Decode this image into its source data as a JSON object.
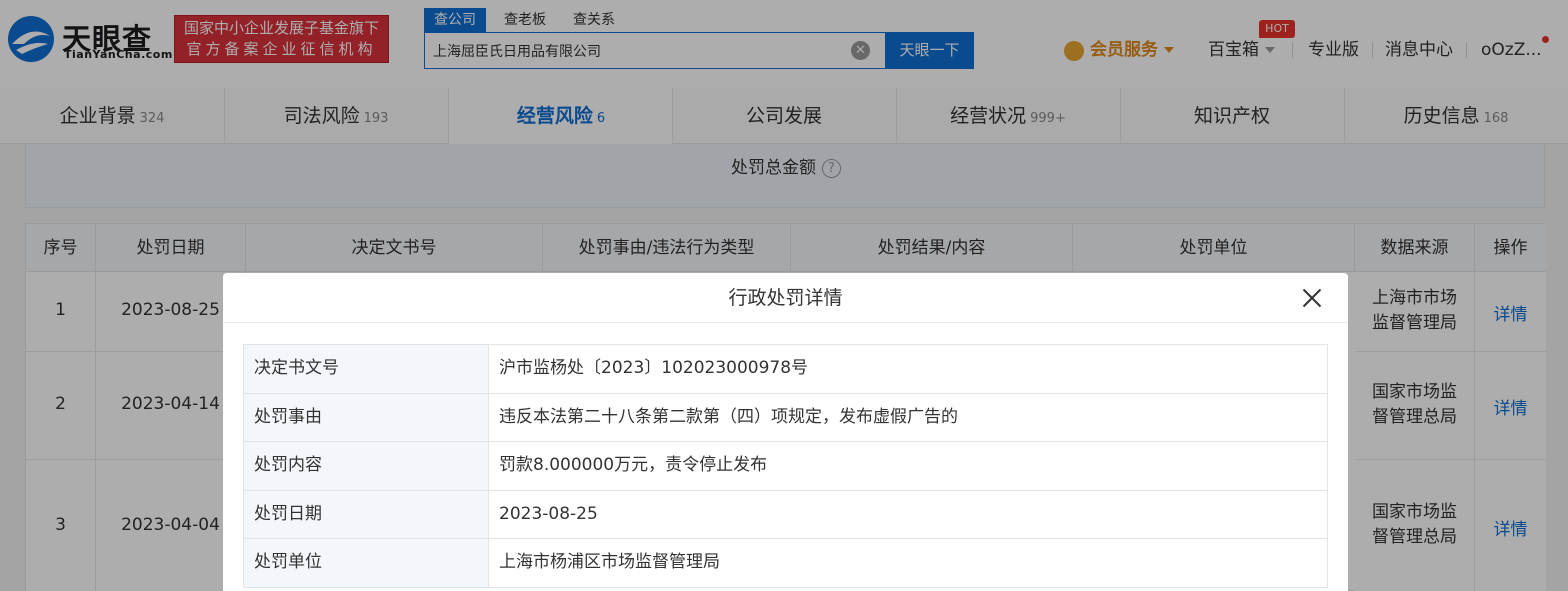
{
  "header": {
    "logo_cn": "天眼查",
    "logo_en": "TianYanCha.com",
    "badge_line1": "国家中小企业发展子基金旗下",
    "badge_line2": "官方备案企业征信机构",
    "search_tabs": [
      "查公司",
      "查老板",
      "查关系"
    ],
    "search_value": "上海屈臣氏日用品有限公司",
    "search_button": "天眼一下",
    "vip_label": "会员服务",
    "treasure_label": "百宝箱",
    "hot_badge": "HOT",
    "pro_label": "专业版",
    "message_label": "消息中心",
    "user_label": "oOzZ..."
  },
  "tabs": [
    {
      "label": "企业背景",
      "count": "324"
    },
    {
      "label": "司法风险",
      "count": "193"
    },
    {
      "label": "经营风险",
      "count": "6"
    },
    {
      "label": "公司发展",
      "count": ""
    },
    {
      "label": "经营状况",
      "count": "999+"
    },
    {
      "label": "知识产权",
      "count": ""
    },
    {
      "label": "历史信息",
      "count": "168"
    }
  ],
  "summary_label": "处罚总金额",
  "table": {
    "headers": [
      "序号",
      "处罚日期",
      "决定文书号",
      "处罚事由/违法行为类型",
      "处罚结果/内容",
      "处罚单位",
      "数据来源",
      "操作"
    ],
    "rows": [
      {
        "index": "1",
        "date": "2023-08-25",
        "source_l1": "上海市市场",
        "source_l2": "监督管理局",
        "action": "详情"
      },
      {
        "index": "2",
        "date": "2023-04-14",
        "source_l1": "国家市场监",
        "source_l2": "督管理总局",
        "action": "详情"
      },
      {
        "index": "3",
        "date": "2023-04-04",
        "source_l1": "国家市场监",
        "source_l2": "督管理总局",
        "action": "详情"
      }
    ]
  },
  "modal": {
    "title": "行政处罚详情",
    "rows": [
      {
        "key": "决定书文号",
        "value": "沪市监杨处〔2023〕102023000978号"
      },
      {
        "key": "处罚事由",
        "value": "违反本法第二十八条第二款第（四）项规定，发布虚假广告的"
      },
      {
        "key": "处罚内容",
        "value": "罚款8.000000万元，责令停止发布"
      },
      {
        "key": "处罚日期",
        "value": "2023-08-25"
      },
      {
        "key": "处罚单位",
        "value": "上海市杨浦区市场监督管理局"
      }
    ]
  },
  "colors": {
    "brand_blue": "#0f6ed1",
    "badge_red": "#d9323a",
    "vip_orange": "#e08a1c"
  }
}
